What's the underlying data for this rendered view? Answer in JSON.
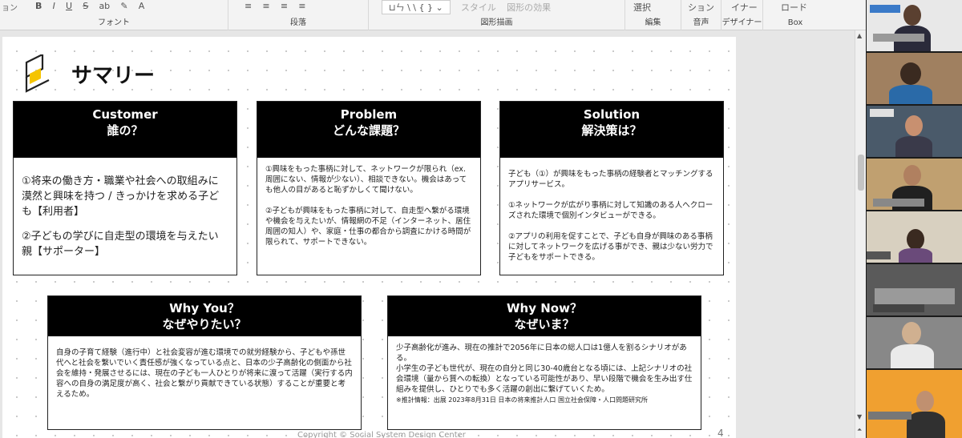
{
  "ribbon": {
    "font_group_label": "フォント",
    "paragraph_group_label": "段落",
    "drawing_group_label": "図形描画",
    "edit_group_label": "編集",
    "voice_group_label": "音声",
    "designer_group_label": "デザイナー",
    "box_group_label": "Box",
    "partial_left": "ョン",
    "bold": "B",
    "italic": "I",
    "underline": "U",
    "strike": "S",
    "ab": "ab",
    "style_label": "スタイル",
    "shape_effect_label": "図形の効果",
    "select_label": "選択",
    "partial_shon": "ション",
    "partial_inaa": "イナー",
    "load_label": "ロード"
  },
  "slide": {
    "title": "サマリー",
    "footer": "Copyright © Social System Design Center",
    "page": "4",
    "customer": {
      "en": "Customer",
      "jp": "誰の？",
      "p1": "①将来の働き方・職業や社会への取組みに漠然と興味を持つ / きっかけを求める子ども【利用者】",
      "p2": "②子どもの学びに自走型の環境を与えたい親【サポーター】"
    },
    "problem": {
      "en": "Problem",
      "jp": "どんな課題？",
      "p1": "①興味をもった事柄に対して、ネットワークが限られ（ex.周囲にない、情報が少ない）、相談できない。機会はあっても他人の目があると恥ずかしくて聞けない。",
      "p2": "②子どもが興味をもった事柄に対して、自走型へ繋がる環境や機会を与えたいが、情報網の不足（インターネット、居住周囲の知人）や、家庭・仕事の都合から調査にかける時間が限られて、サポートできない。"
    },
    "solution": {
      "en": "Solution",
      "jp": "解決策は？",
      "p1": "子ども（①）が興味をもった事柄の経験者とマッチングするアプリサービス。",
      "p2": "①ネットワークが広がり事柄に対して知識のある人へクローズされた環境で個別インタビューができる。",
      "p3": "②アプリの利用を促すことで、子ども自身が興味のある事柄に対してネットワークを広げる事ができ、親は少ない労力で子どもをサポートできる。"
    },
    "whyyou": {
      "en": "Why You？",
      "jp": "なぜやりたい？",
      "p1": "自身の子育て経験（進行中）と社会変容が進む環境での就労経験から、子どもや孫世代へと社会を繋いでいく責任感が強くなっている点と、日本の少子高齢化の側面から社会を維持・発展させるには、現在の子ども一人ひとりが将来に渡って活躍（実行する内容への自身の満足度が高く、社会と繋がり貢献できている状態）することが重要と考えるため。"
    },
    "whynow": {
      "en": "Why Now？",
      "jp": "なぜいま？",
      "p1": "少子高齢化が進み、現在の推計で2056年に日本の総人口は1億人を割るシナリオがある。",
      "p2": "小学生の子ども世代が、現在の自分と同じ30-40歳台となる頃には、上記シナリオの社会環境（量から質への転換）となっている可能性があり、早い段階で機会を生み出す仕組みを提供し、ひとりでも多く活躍の創出に繋げていくため。",
      "note": "※推計情報：出展 2023年8月31日 日本の将来推計人口 国立社会保障・人口問題研究所"
    }
  },
  "colors": {
    "ribbon_bg": "#f3f3f3",
    "card_header": "#000000",
    "logo_yellow": "#f5c400",
    "panel_bg": "#1b1b1b"
  }
}
